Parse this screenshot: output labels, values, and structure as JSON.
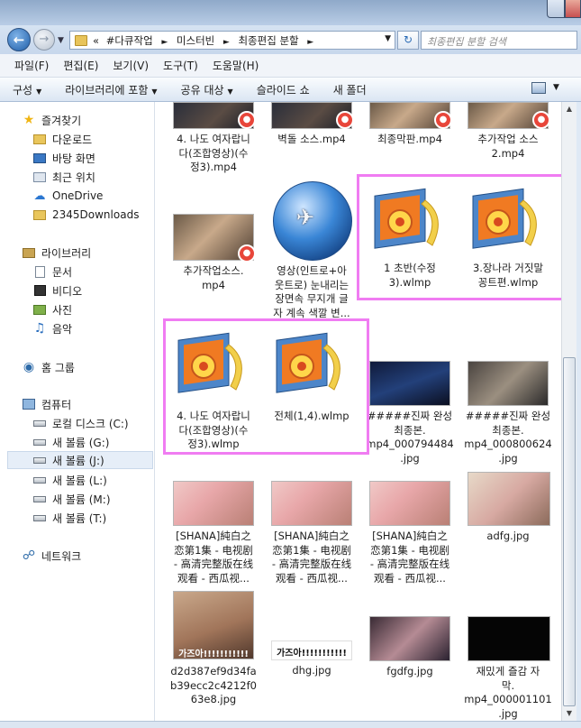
{
  "window": {
    "address_path": [
      "#다큐작업",
      "미스터빈",
      "최종편집 분할"
    ],
    "address_prefix": "«",
    "search_placeholder": "최종편집 분할 검색"
  },
  "menu": [
    "파일(F)",
    "편집(E)",
    "보기(V)",
    "도구(T)",
    "도움말(H)"
  ],
  "toolbar": {
    "items": [
      {
        "label": "구성",
        "dropdown": true
      },
      {
        "label": "라이브러리에 포함",
        "dropdown": true
      },
      {
        "label": "공유 대상",
        "dropdown": true
      },
      {
        "label": "슬라이드 쇼",
        "dropdown": false
      },
      {
        "label": "새 폴더",
        "dropdown": false
      }
    ]
  },
  "nav": [
    {
      "label": "즐겨찾기",
      "icon": "star-icon"
    },
    {
      "label": "다운로드",
      "icon": "downloads-folder-icon"
    },
    {
      "label": "바탕 화면",
      "icon": "desktop-icon"
    },
    {
      "label": "최근 위치",
      "icon": "recent-places-icon"
    },
    {
      "label": "OneDrive",
      "icon": "onedrive-icon"
    },
    {
      "label": "2345Downloads",
      "icon": "folder-icon"
    },
    {
      "label": "라이브러리",
      "icon": "library-icon"
    },
    {
      "label": "문서",
      "icon": "documents-icon"
    },
    {
      "label": "비디오",
      "icon": "videos-icon"
    },
    {
      "label": "사진",
      "icon": "pictures-icon"
    },
    {
      "label": "음악",
      "icon": "music-icon"
    },
    {
      "label": "홈 그룹",
      "icon": "homegroup-icon"
    },
    {
      "label": "컴퓨터",
      "icon": "computer-icon"
    },
    {
      "label": "로컬 디스크 (C:)",
      "icon": "local-disk-icon"
    },
    {
      "label": "새 볼륨 (G:)",
      "icon": "drive-icon"
    },
    {
      "label": "새 볼륨 (J:)",
      "icon": "drive-icon",
      "selected": true
    },
    {
      "label": "새 볼륨 (L:)",
      "icon": "drive-icon"
    },
    {
      "label": "새 볼륨 (M:)",
      "icon": "drive-icon"
    },
    {
      "label": "새 볼륨 (T:)",
      "icon": "drive-icon"
    },
    {
      "label": "네트워크",
      "icon": "network-icon"
    }
  ],
  "files": [
    {
      "lines": [
        "4. 나도 여자랍니",
        "다(조합영상)(수",
        "정3).mp4"
      ],
      "type": "video",
      "thumb": "ph-dark"
    },
    {
      "lines": [
        "벽돌 소스.mp4"
      ],
      "type": "video",
      "thumb": "ph-dark"
    },
    {
      "lines": [
        "최종막판.mp4"
      ],
      "type": "video",
      "thumb": "ph-room"
    },
    {
      "lines": [
        "추가작업 소스",
        "2.mp4"
      ],
      "type": "video",
      "thumb": "ph-room"
    },
    {
      "lines": [
        "추가작업소스.",
        "mp4"
      ],
      "type": "video",
      "thumb": "ph-room"
    },
    {
      "lines": [
        "영상(인트로+아",
        "웃트로) 눈내리는",
        "장면속 무지개 글",
        "자 계속 색깔 변..."
      ],
      "type": "globe"
    },
    {
      "lines": [
        "1 초반(수정",
        "3).wlmp"
      ],
      "type": "wlmp"
    },
    {
      "lines": [
        "3.장나라 거짓말",
        "꽁트편.wlmp"
      ],
      "type": "wlmp"
    },
    {
      "lines": [
        "4. 나도 여자랍니",
        "다(조합영상)(수",
        "정3).wlmp"
      ],
      "type": "wlmp"
    },
    {
      "lines": [
        "전체(1,4).wlmp"
      ],
      "type": "wlmp"
    },
    {
      "lines": [
        "#####진짜 완성",
        "최종본.",
        "mp4_000794484",
        ".jpg"
      ],
      "type": "image",
      "thumb": "ph-stage"
    },
    {
      "lines": [
        "#####진짜 완성",
        "최종본.",
        "mp4_000800624",
        ".jpg"
      ],
      "type": "image",
      "thumb": "ph-cat"
    },
    {
      "lines": [
        "[SHANA]純白之",
        "恋第1集 - 电视剧",
        "- 高清完整版在线",
        "观看 - 西瓜视..."
      ],
      "type": "image",
      "thumb": "ph-bed"
    },
    {
      "lines": [
        "[SHANA]純白之",
        "恋第1集 - 电视剧",
        "- 高清完整版在线",
        "观看 - 西瓜视..."
      ],
      "type": "image",
      "thumb": "ph-bed"
    },
    {
      "lines": [
        "[SHANA]純白之",
        "恋第1集 - 电视剧",
        "- 高清完整版在线",
        "观看 - 西瓜视..."
      ],
      "type": "image",
      "thumb": "ph-bed"
    },
    {
      "lines": [
        "adfg.jpg"
      ],
      "type": "image",
      "thumb": "ph-girl"
    },
    {
      "lines": [
        "d2d387ef9d34fa",
        "b39ecc2c4212f0",
        "63e8.jpg"
      ],
      "type": "image",
      "thumb": "ph-face",
      "overlay": "가즈아!!!!!!!!!!!"
    },
    {
      "lines": [
        "dhg.jpg"
      ],
      "type": "image",
      "thumb": "ph-white",
      "overlay": "가즈아!!!!!!!!!!!"
    },
    {
      "lines": [
        "fgdfg.jpg"
      ],
      "type": "image",
      "thumb": "ph-group"
    },
    {
      "lines": [
        "재밌게 즐감 자",
        "막.",
        "mp4_000001101",
        ".jpg"
      ],
      "type": "image",
      "thumb": "ph-black"
    }
  ]
}
